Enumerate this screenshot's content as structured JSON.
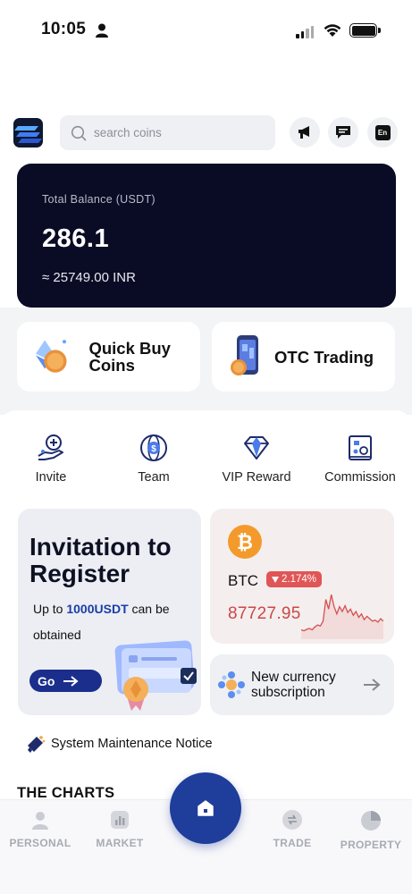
{
  "status_bar": {
    "time": "10:05"
  },
  "search": {
    "placeholder": "search coins"
  },
  "header": {
    "lang_label": "En"
  },
  "balance": {
    "label": "Total Balance (USDT)",
    "value": "286.1",
    "inr": "≈ 25749.00 INR"
  },
  "quick_cards": {
    "quick_buy": "Quick Buy Coins",
    "otc": "OTC Trading"
  },
  "menu": [
    {
      "label": "Invite",
      "icon": "invite-icon"
    },
    {
      "label": "Team",
      "icon": "team-icon"
    },
    {
      "label": "VIP Reward",
      "icon": "diamond-icon"
    },
    {
      "label": "Commission",
      "icon": "commission-icon"
    }
  ],
  "invitation": {
    "title": "Invitation to Register",
    "sub_prefix": "Up to ",
    "sub_amount": "1000USDT",
    "sub_suffix": " can be obtained",
    "go_label": "Go"
  },
  "btc": {
    "symbol": "BTC",
    "change": "2.174%",
    "price": "87727.95",
    "sparkline": [
      0.12,
      0.1,
      0.13,
      0.15,
      0.12,
      0.18,
      0.22,
      0.2,
      0.3,
      0.75,
      0.55,
      0.85,
      0.6,
      0.45,
      0.6,
      0.5,
      0.62,
      0.48,
      0.55,
      0.42,
      0.5,
      0.38,
      0.45,
      0.33,
      0.4,
      0.35,
      0.3,
      0.32,
      0.28,
      0.35,
      0.3
    ]
  },
  "new_currency": {
    "label": "New currency subscription"
  },
  "notice": {
    "label": "System Maintenance Notice"
  },
  "charts": {
    "title": "THE CHARTS"
  },
  "nav": {
    "personal": "PERSONAL",
    "market": "MARKET",
    "trade": "TRADE",
    "property": "PROPERTY"
  },
  "colors": {
    "brand_blue": "#1f3d9a",
    "balance_bg": "#0a0c25",
    "down_red": "#e05555",
    "btc_orange": "#f39a2b"
  }
}
